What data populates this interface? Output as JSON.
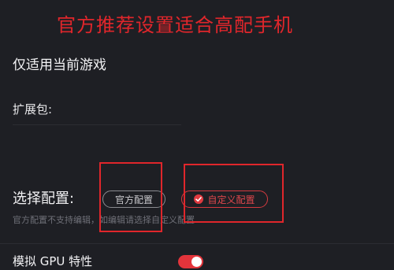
{
  "overlay_caption": "官方推荐设置适合高配手机",
  "section_title": "仅适用当前游戏",
  "extension_label": "扩展包:",
  "config": {
    "label": "选择配置:",
    "options": [
      {
        "label": "官方配置",
        "selected": false
      },
      {
        "label": "自定义配置",
        "selected": true
      }
    ],
    "hint": "官方配置不支持编辑，如编辑请选择自定义配置"
  },
  "gpu": {
    "label": "模拟 GPU 特性",
    "enabled": true
  },
  "colors": {
    "accent": "#e0262b",
    "background": "#1e1f24"
  }
}
